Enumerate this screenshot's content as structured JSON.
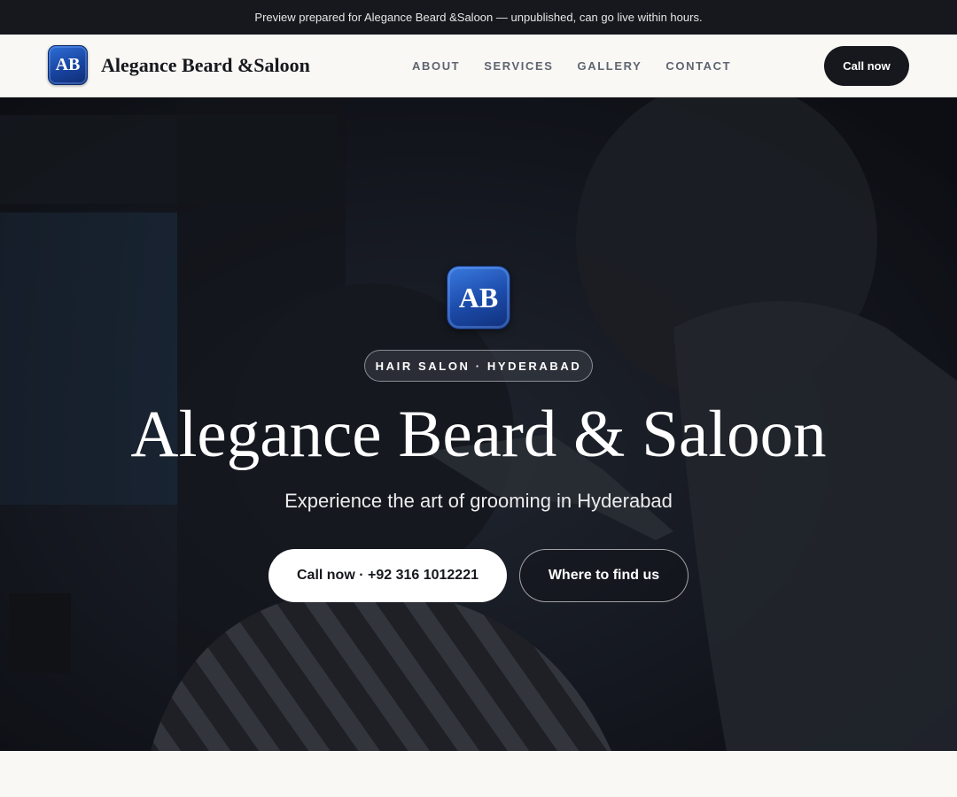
{
  "preview_bar": {
    "text": "Preview prepared for Alegance Beard &Saloon — unpublished, can go live within hours."
  },
  "header": {
    "logo_initials": "AB",
    "brand_name": "Alegance Beard &Saloon",
    "nav": [
      "ABOUT",
      "SERVICES",
      "GALLERY",
      "CONTACT"
    ],
    "call_label": "Call now"
  },
  "hero": {
    "background_image": "barber trimming a customer's hair with clippers, dark barbershop interior",
    "logo_initials": "AB",
    "badge": "HAIR SALON · HYDERABAD",
    "title": "Alegance Beard & Saloon",
    "subtitle": "Experience the art of grooming in Hyderabad",
    "primary_cta": "Call now · +92 316 1012221",
    "secondary_cta": "Where to find us"
  },
  "colors": {
    "dark": "#16181d",
    "page_bg": "#f9f8f5",
    "logo_blue": "#1844a0",
    "nav_text": "#5f6470"
  }
}
